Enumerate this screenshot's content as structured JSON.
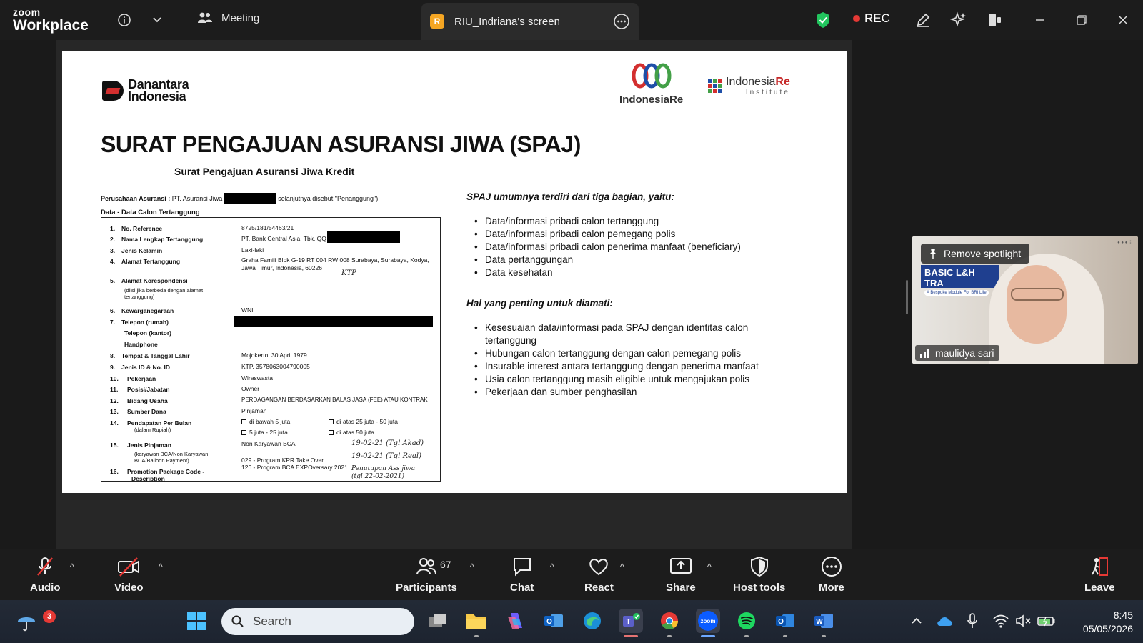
{
  "app": {
    "brand_top": "zoom",
    "brand_bottom": "Workplace"
  },
  "header": {
    "meeting_label": "Meeting",
    "screen_tab": {
      "initial": "R",
      "title": "RIU_Indriana's screen"
    },
    "rec_label": "REC"
  },
  "slide": {
    "danantara_logo": "Danantara Indonesia",
    "indonesiare_logo": "IndonesiaRe",
    "indonesiare_institute_logo": {
      "name_a": "Indonesia",
      "name_b": "Re",
      "sub": "Institute"
    },
    "title": "SURAT PENGAJUAN ASURANSI JIWA (SPAJ)",
    "form_title": "Surat Pengajuan Asuransi Jiwa Kredit",
    "company_prefix": "Perusahaan Asuransi :",
    "company_value": "PT. Asuransi Jiwa",
    "company_suffix": "selanjutnya disebut \"Penanggung\")",
    "data_heading": "Data - Data Calon Tertanggung",
    "form_rows": [
      {
        "no": "1.",
        "label": "No. Reference",
        "value": "8725/181/54463/21"
      },
      {
        "no": "2.",
        "label": "Nama Lengkap Tertanggung",
        "value": "PT. Bank Central Asia, Tbk. QQ"
      },
      {
        "no": "3.",
        "label": "Jenis Kelamin",
        "value": "Laki-laki"
      },
      {
        "no": "4.",
        "label": "Alamat Tertanggung",
        "value": "Graha Famili Blok G-19 RT 004 RW 008 Surabaya, Surabaya, Kodya,",
        "value2": "Jawa Timur, Indonesia, 60226"
      },
      {
        "no": "5.",
        "label": "Alamat Korespondensi",
        "note": "(diisi jika berbeda dengan alamat",
        "note2": "tertanggung)"
      },
      {
        "no": "6.",
        "label": "Kewarganegaraan",
        "value": "WNI"
      },
      {
        "no": "7.",
        "label": "Telepon (rumah)",
        "sub1": "Telepon (kantor)",
        "sub2": "Handphone"
      },
      {
        "no": "8.",
        "label": "Tempat & Tanggal Lahir",
        "value": "Mojokerto, 30 April 1979"
      },
      {
        "no": "9.",
        "label": "Jenis ID & No. ID",
        "value": "KTP, 3578063004790005"
      },
      {
        "no": "10.",
        "label": "Pekerjaan",
        "value": "Wiraswasta"
      },
      {
        "no": "11.",
        "label": "Posisi/Jabatan",
        "value": "Owner"
      },
      {
        "no": "12.",
        "label": "Bidang Usaha",
        "value": "PERDAGANGAN BERDASARKAN BALAS JASA (FEE) ATAU KONTRAK"
      },
      {
        "no": "13.",
        "label": "Sumber Dana",
        "value": "Pinjaman"
      },
      {
        "no": "14.",
        "label": "Pendapatan Per Bulan",
        "note": "(dalam Rupiah)",
        "opt1": "di bawah 5 juta",
        "opt2": "di atas 25 juta - 50 juta",
        "opt3": "5 juta - 25 juta",
        "opt4": "di atas 50 juta"
      },
      {
        "no": "15.",
        "label": "Jenis Pinjaman",
        "value": "Non Karyawan BCA",
        "note": "(karyawan BCA/Non Karyawan",
        "note2": "BCA/Balloon Payment)"
      },
      {
        "no": "16.",
        "label": "Promotion Package Code -",
        "label2": "Description",
        "value": "029 - Program KPR Take Over",
        "value2": "126 - Program BCA EXPOversary 2021"
      }
    ],
    "handwriting": {
      "ktp": "KTP",
      "line1": "19-02-21 (Tgl Akad)",
      "line2": "19-02-21 (Tgl Real)",
      "line3": "Penutupan Ass jiwa",
      "line4": "(tgl 22-02-2021)"
    },
    "right": {
      "heading1": "SPAJ umumnya terdiri dari tiga bagian, yaitu:",
      "list1": [
        "Data/informasi pribadi calon tertanggung",
        "Data/informasi pribadi calon pemegang polis",
        "Data/informasi pribadi calon penerima manfaat (beneficiary)",
        "Data pertanggungan",
        "Data kesehatan"
      ],
      "heading2": "Hal yang penting untuk diamati:",
      "list2": [
        "Kesesuaian data/informasi pada SPAJ dengan identitas calon tertanggung",
        "Hubungan calon tertanggung dengan calon pemegang polis",
        "Insurable interest antara tertanggung dengan penerima manfaat",
        "Usia calon tertanggung masih eligible untuk mengajukan polis",
        "Pekerjaan dan sumber penghasilan"
      ]
    }
  },
  "video_tile": {
    "spotlight_label": "Remove spotlight",
    "participant_name": "maulidya sari",
    "banner_title": "BASIC L&H TRA",
    "banner_sub": "A Bespoke Module For BRI Life"
  },
  "toolbar": {
    "audio": "Audio",
    "video": "Video",
    "participants": "Participants",
    "participants_count": "67",
    "chat": "Chat",
    "react": "React",
    "share": "Share",
    "host_tools": "Host tools",
    "more": "More",
    "leave": "Leave"
  },
  "taskbar": {
    "weather_badge": "3",
    "search_placeholder": "Search",
    "zoom_label": "zoom",
    "time": "8:45",
    "date": "05/05/2026"
  },
  "colors": {
    "accent_red": "#e53935",
    "zoom_blue": "#0b5cff",
    "shield_green": "#22c55e"
  }
}
